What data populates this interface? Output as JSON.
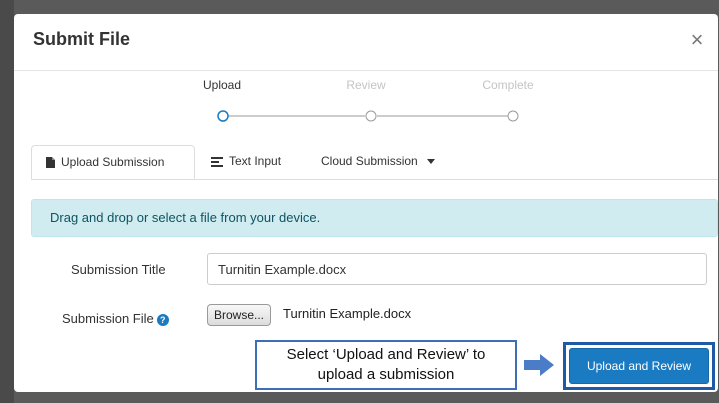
{
  "modal": {
    "title": "Submit File",
    "close_label": "×"
  },
  "stepper": {
    "steps": [
      {
        "label": "Upload",
        "state": "active"
      },
      {
        "label": "Review",
        "state": "inactive"
      },
      {
        "label": "Complete",
        "state": "inactive"
      }
    ]
  },
  "tabs": [
    {
      "label": "Upload Submission",
      "icon": "file-icon",
      "active": true
    },
    {
      "label": "Text Input",
      "icon": "text-lines-icon",
      "active": false
    },
    {
      "label": "Cloud Submission",
      "icon": "caret-down-icon",
      "active": false
    }
  ],
  "alert": {
    "text": "Drag and drop or select a file from your device."
  },
  "form": {
    "title_label": "Submission Title",
    "title_value": "Turnitin Example.docx",
    "file_label": "Submission File",
    "help_glyph": "?",
    "browse_label": "Browse...",
    "file_name": "Turnitin Example.docx"
  },
  "annotation": {
    "line1": "Select ‘Upload and Review’ to",
    "line2": "upload a submission"
  },
  "actions": {
    "primary_label": "Upload and Review"
  },
  "colors": {
    "primary": "#1a7bc2",
    "alert_bg": "#d1ecf1",
    "alert_text": "#0c5460",
    "annotation_border": "#3d6fb6",
    "arrow": "#4a7cc7"
  }
}
